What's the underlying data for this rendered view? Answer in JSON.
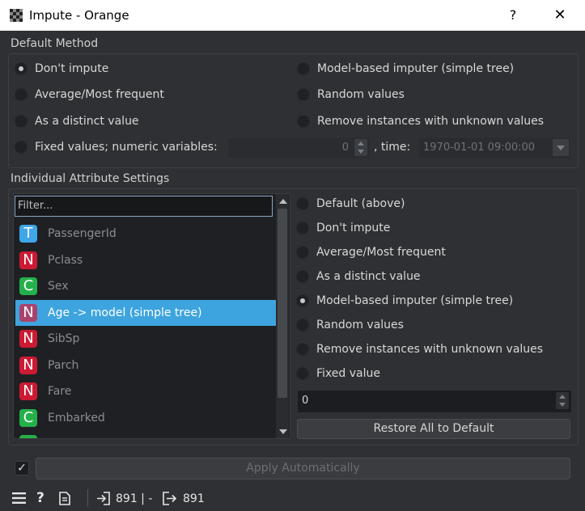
{
  "window": {
    "title": "Impute - Orange",
    "help_glyph": "?",
    "close_glyph": "✕"
  },
  "default_method": {
    "title": "Default Method",
    "options": [
      "Don't impute",
      "Average/Most frequent",
      "As a distinct value",
      "Fixed values; numeric variables:",
      "Model-based imputer (simple tree)",
      "Random values",
      "Remove instances with unknown values"
    ],
    "selected": "Don't impute",
    "numeric_value": "0",
    "time_label": ", time:",
    "time_value": "1970-01-01 09:00:00"
  },
  "individual": {
    "title": "Individual Attribute Settings",
    "filter_placeholder": "Filter...",
    "attributes": [
      {
        "type": "T",
        "name": "PassengerId",
        "color": "#3fa6e8"
      },
      {
        "type": "N",
        "name": "Pclass",
        "color": "#cc1a33"
      },
      {
        "type": "C",
        "name": "Sex",
        "color": "#24b04a"
      },
      {
        "type": "N",
        "name": "Age -> model (simple tree)",
        "color": "#a8446c"
      },
      {
        "type": "N",
        "name": "SibSp",
        "color": "#cc1a33"
      },
      {
        "type": "N",
        "name": "Parch",
        "color": "#cc1a33"
      },
      {
        "type": "N",
        "name": "Fare",
        "color": "#cc1a33"
      },
      {
        "type": "C",
        "name": "Embarked",
        "color": "#24b04a"
      }
    ],
    "selected_attribute": "Age -> model (simple tree)",
    "methods": [
      "Default (above)",
      "Don't impute",
      "Average/Most frequent",
      "As a distinct value",
      "Model-based imputer (simple tree)",
      "Random values",
      "Remove instances with unknown values",
      "Fixed value"
    ],
    "selected_method": "Model-based imputer (simple tree)",
    "fixed_value": "0",
    "restore_label": "Restore All to Default"
  },
  "apply": {
    "checked": true,
    "check_glyph": "✓",
    "label": "Apply Automatically"
  },
  "status": {
    "input_count": "891 | -",
    "output_count": "891"
  }
}
